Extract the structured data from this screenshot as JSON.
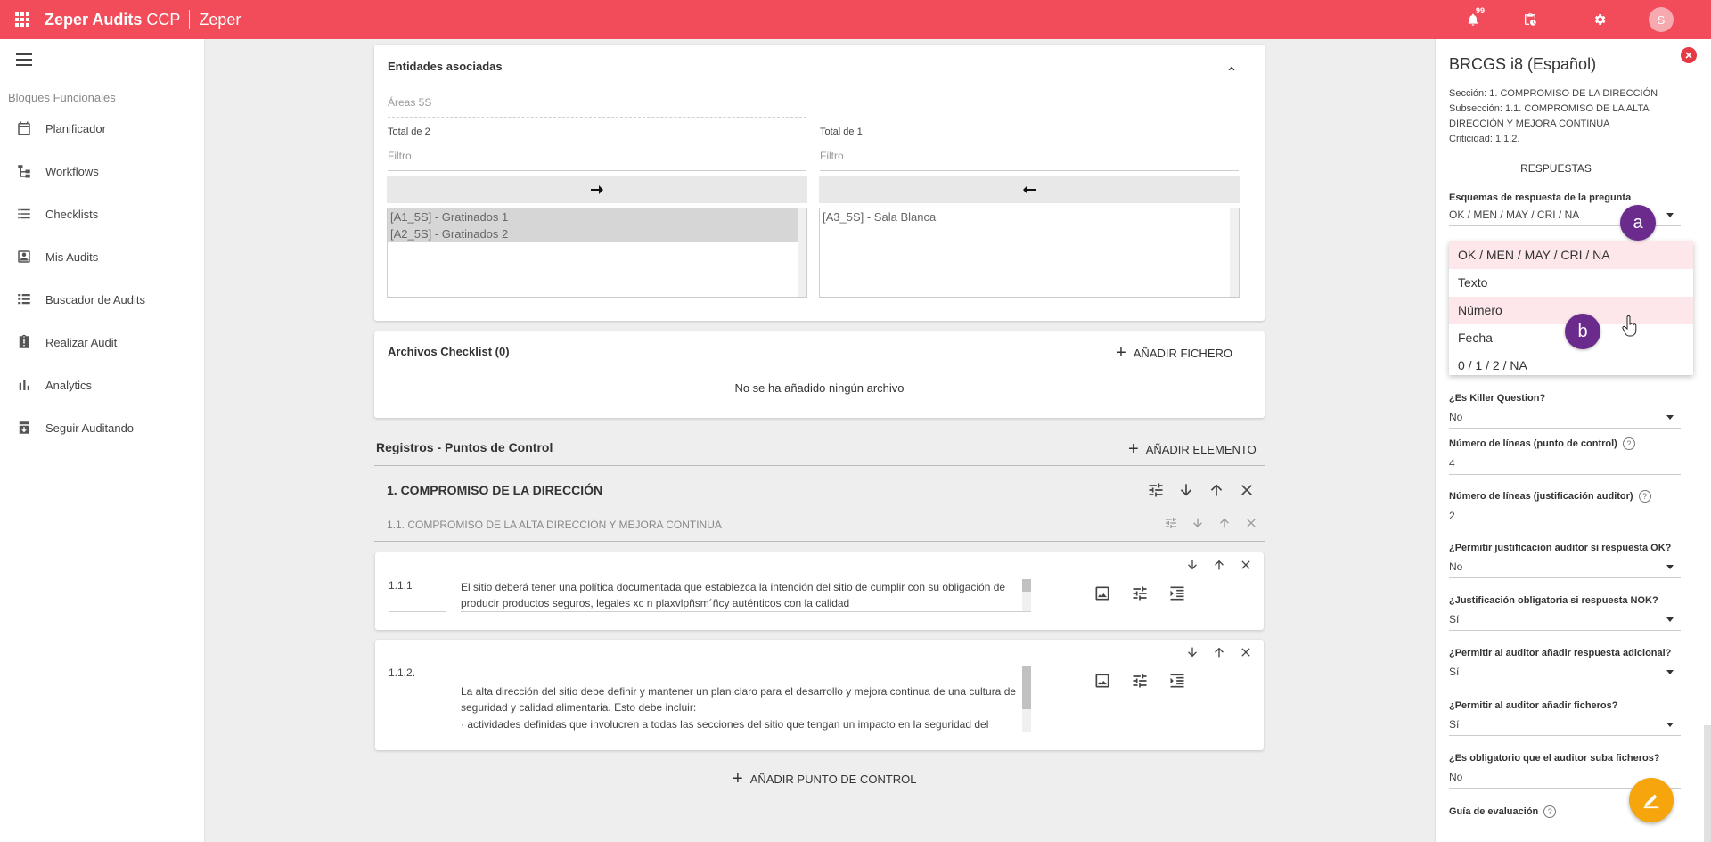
{
  "topbar": {
    "app_name": "Zeper Audits",
    "app_suffix": "CCP",
    "org": "Zeper",
    "notifications_count": "99",
    "avatar_initial": "S",
    "color": "#f24c5a"
  },
  "sidebar": {
    "section_title": "Bloques Funcionales",
    "items": [
      {
        "label": "Planificador",
        "icon": "calendar-icon"
      },
      {
        "label": "Workflows",
        "icon": "workflow-icon"
      },
      {
        "label": "Checklists",
        "icon": "list-icon"
      },
      {
        "label": "Mis Audits",
        "icon": "contact-icon"
      },
      {
        "label": "Buscador de Audits",
        "icon": "list-search-icon"
      },
      {
        "label": "Realizar Audit",
        "icon": "clipboard-alert-icon"
      },
      {
        "label": "Analytics",
        "icon": "bar-chart-icon"
      },
      {
        "label": "Seguir Auditando",
        "icon": "archive-down-icon"
      }
    ]
  },
  "entidades": {
    "title": "Entidades asociadas",
    "field_placeholder": "Áreas 5S",
    "left_total": "Total de 2",
    "right_total": "Total de 1",
    "filter_placeholder": "Filtro",
    "left_items": [
      "[A1_5S] - Gratinados 1",
      "[A2_5S] - Gratinados 2"
    ],
    "right_items": [
      "[A3_5S] - Sala Blanca"
    ]
  },
  "archivos": {
    "title": "Archivos Checklist (0)",
    "add_label": "AÑADIR FICHERO",
    "empty_text": "No se ha añadido ningún archivo"
  },
  "registros": {
    "title": "Registros - Puntos de Control",
    "add_element_label": "AÑADIR ELEMENTO",
    "section_title": "1. COMPROMISO DE LA DIRECCIÓN",
    "subsection_title": "1.1. COMPROMISO DE LA ALTA DIRECCIÓN Y MEJORA CONTINUA",
    "points": [
      {
        "code": "1.1.1",
        "text": "El sitio deberá tener una política documentada que establezca la intención del sitio de cumplir con su obligación de producir productos seguros, legales xc n plaxvlpñsm´ñcy auténticos con la calidad"
      },
      {
        "code": "1.1.2.",
        "text": "La alta dirección del sitio debe definir y mantener un plan claro para el desarrollo y mejora continua de una cultura de seguridad y calidad alimentaria. Esto debe incluir:\n· actividades definidas que involucren a todas las secciones del sitio que tengan un impacto en la seguridad del producto."
      }
    ],
    "add_point_label": "AÑADIR PUNTO DE CONTROL"
  },
  "panel": {
    "title": "BRCGS i8 (Español)",
    "seccion": "Sección: 1. COMPROMISO DE LA DIRECCIÓN",
    "subseccion": "Subsección: 1.1. COMPROMISO DE LA ALTA DIRECCIÓN Y MEJORA CONTINUA",
    "criticidad": "Criticidad: 1.1.2.",
    "respuestas_heading": "RESPUESTAS",
    "esquema_label": "Esquemas de respuesta de la pregunta",
    "esquema_value": "OK / MEN / MAY / CRI / NA",
    "dropdown_options": [
      "OK / MEN / MAY / CRI / NA",
      "Texto",
      "Número",
      "Fecha",
      "0 / 1 / 2 / NA"
    ],
    "fields": [
      {
        "label": "¿Es Killer Question?",
        "value": "No"
      },
      {
        "label": "Número de líneas (punto de control)",
        "value": "4"
      },
      {
        "label": "Número de líneas (justificación auditor)",
        "value": "2"
      },
      {
        "label": "¿Permitir justificación auditor si respuesta OK?",
        "value": "No"
      },
      {
        "label": "¿Justificación obligatoria si respuesta NOK?",
        "value": "Sí"
      },
      {
        "label": "¿Permitir al auditor añadir respuesta adicional?",
        "value": "Sí"
      },
      {
        "label": "¿Permitir al auditor añadir ficheros?",
        "value": "Sí"
      },
      {
        "label": "¿Es obligatorio que el auditor suba ficheros?",
        "value": "No"
      }
    ],
    "guia_label": "Guía de evaluación"
  },
  "markers": {
    "a": "a",
    "b": "b"
  }
}
